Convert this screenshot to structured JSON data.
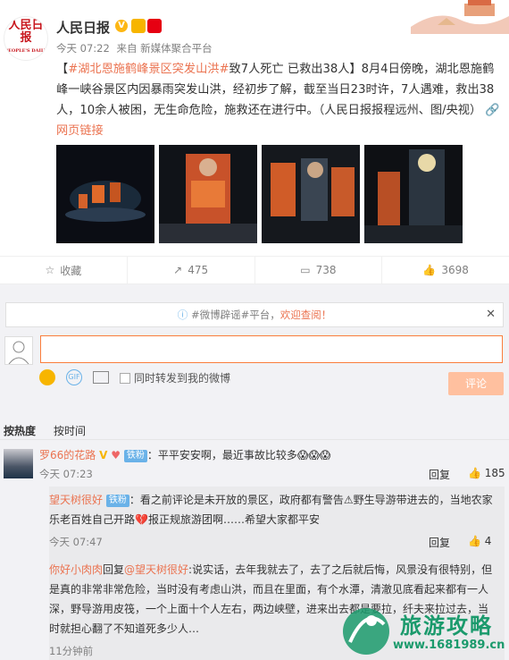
{
  "post": {
    "username": "人民日报",
    "logo_text": "人民日报",
    "logo_sub": "PEOPLE'S DAILY",
    "verified": "V",
    "time": "今天 07:22",
    "source": "来自 新媒体聚合平台",
    "hashtag": "#湖北恩施鹤峰景区突发山洪#",
    "headline": "致7人死亡 已救出38人",
    "body": "】8月4日傍晚，湖北恩施鹤峰一峡谷景区内因暴雨突发山洪，经初步了解，截至当日23时许，7人遇难，救出38人，10余人被困，无生命危险，施救还在进行中。（人民日报报程远州、图/央视）",
    "open_bracket": "【",
    "link_label": "网页链接",
    "image_count": 4
  },
  "actions": {
    "favorite": "收藏",
    "repost": "475",
    "comment": "738",
    "like": "3698"
  },
  "notice": {
    "text_before": "#微博辟谣#平台，",
    "link": "欢迎查阅！",
    "close": "✕"
  },
  "compose": {
    "repost_checkbox": "同时转发到我的微博",
    "submit": "评论",
    "value": ""
  },
  "sort": {
    "hot": "按热度",
    "time": "按时间"
  },
  "comments": [
    {
      "name": "罗66的花路",
      "badge": "铁粉",
      "text": "：平平安安啊，最近事故比较多😱😱😱",
      "time": "今天 07:23",
      "reply": "回复",
      "likes": "185"
    }
  ],
  "subcomments": [
    {
      "name": "望天树很好",
      "badge": "铁粉",
      "text": "：看之前评论是未开放的景区，政府都有警告⚠野生导游带进去的，当地农家乐老百姓自己开路💔报正规旅游团啊……希望大家都平安",
      "time": "今天 07:47",
      "reply": "回复",
      "likes": "4"
    },
    {
      "name": "你好小肉肉",
      "reply_to": "回复",
      "mention": "@望天树很好",
      "text": ":说实话，去年我就去了，去了之后就后悔，风景没有很特别，但是真的非常非常危险，当时没有考虑山洪，而且在里面，有个水潭，清澈见底看起来都有一人深，野导游用皮筏，一个上面十个人左右，两边峡壁，进来出去都是要拉，纤夫来拉过去，当时就担心翻了不知道死多少人…",
      "time": "11分钟前"
    }
  ],
  "watermark": {
    "title": "旅游攻略",
    "url": "www.1681989.cn"
  },
  "colors": {
    "accent": "#eb7350",
    "blue_link": "#eb7350",
    "submit_bg": "#ffc09f",
    "badge_blue": "#6ab2e8"
  }
}
